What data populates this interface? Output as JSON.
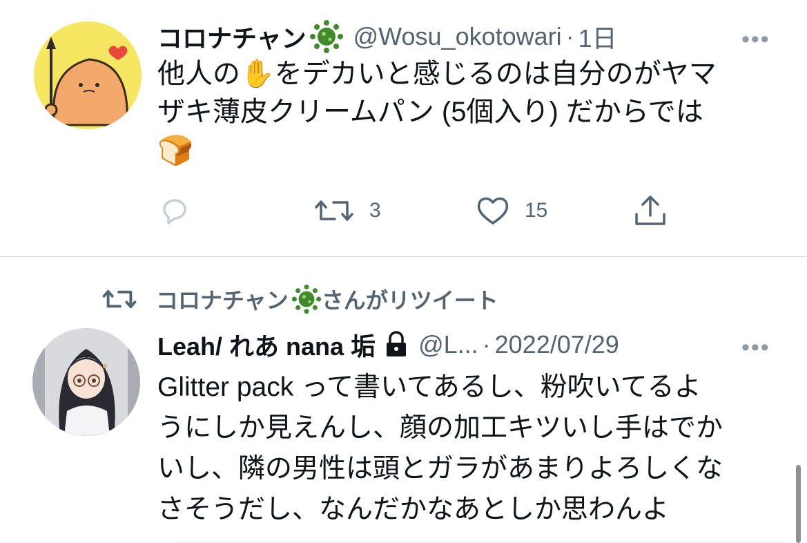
{
  "tweet1": {
    "name": "コロナチャン",
    "handle": "@Wosu_okotowari",
    "separator": "·",
    "time": "1日",
    "more": "•••",
    "text_part1": "他人の",
    "hand_emoji": "✋",
    "text_part2": "をデカいと感じるのは自分のがヤマ",
    "text_line2": "ザキ薄皮クリームパン (5個入り) だからでは",
    "bread_emoji": "🍞",
    "retweet_count": "3",
    "like_count": "15"
  },
  "retweet_banner": {
    "name": "コロナチャン",
    "suffix": "さんがリツイート"
  },
  "tweet2": {
    "name": "Leah/ れあ nana 垢",
    "handle": "@L...",
    "separator": "·",
    "time": "2022/07/29",
    "more": "•••",
    "lines": [
      "Glitter pack って書いてあるし、粉吹いてるよ",
      "うにしか見えんし、顔の加工キツいし手はでか",
      "いし、隣の男性は頭とガラがあまりよろしくな",
      "さそうだし、なんだかなあとしか思わんよ"
    ]
  },
  "colors": {
    "text": "#0f1419",
    "secondary": "#536471",
    "divider": "#cfd9de",
    "avatar1_bg": "#f7e661",
    "virus": "#3f8a2b"
  },
  "icons": [
    "virus-emoji-icon",
    "reply-icon",
    "retweet-icon",
    "like-icon",
    "share-icon",
    "lock-icon",
    "more-icon"
  ]
}
